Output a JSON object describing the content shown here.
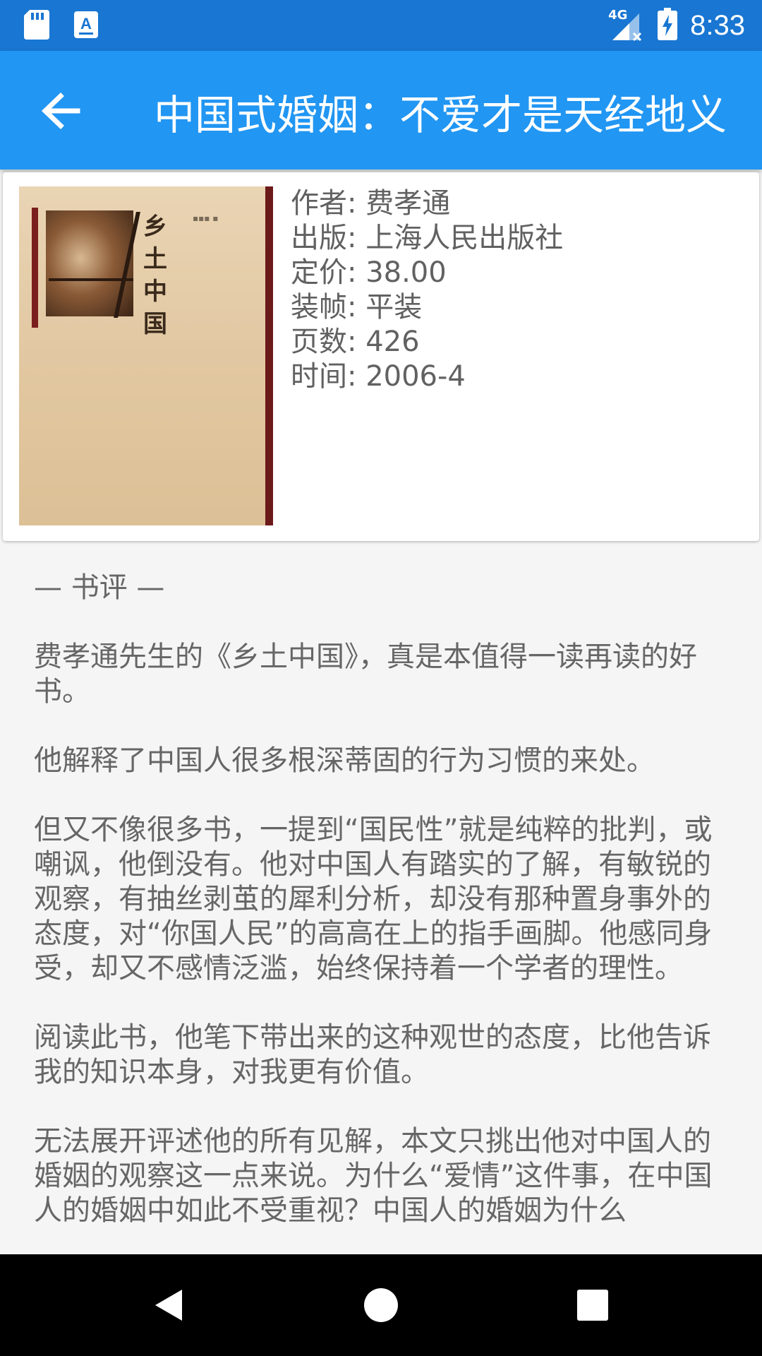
{
  "status_bar": {
    "time": "8:33",
    "network": "4G",
    "icons": [
      "sd-card-icon",
      "text-app-icon",
      "signal-icon",
      "battery-charging-icon"
    ]
  },
  "app_bar": {
    "title": "中国式婚姻：不爱才是天经地义",
    "back_icon": "arrow-back-icon"
  },
  "book": {
    "cover_title": "乡土中国",
    "meta": [
      "作者: 费孝通",
      "出版: 上海人民出版社",
      "定价: 38.00",
      "装帧: 平装",
      "页数: 426",
      "时间: 2006-4"
    ]
  },
  "review": {
    "heading": "— 书评 —",
    "paragraphs": [
      "费孝通先生的《乡土中国》，真是本值得一读再读的好书。",
      "他解释了中国人很多根深蒂固的行为习惯的来处。",
      "但又不像很多书，一提到“国民性”就是纯粹的批判，或嘲讽，他倒没有。他对中国人有踏实的了解，有敏锐的观察，有抽丝剥茧的犀利分析，却没有那种置身事外的态度，对“你国人民”的高高在上的指手画脚。他感同身受，却又不感情泛滥，始终保持着一个学者的理性。",
      "阅读此书，他笔下带出来的这种观世的态度，比他告诉我的知识本身，对我更有价值。",
      "无法展开评述他的所有见解，本文只挑出他对中国人的婚姻的观察这一点来说。为什么“爱情”这件事，在中国人的婚姻中如此不受重视？中国人的婚姻为什么"
    ]
  },
  "nav_bar": {
    "icons": [
      "back-triangle-icon",
      "home-circle-icon",
      "recents-square-icon"
    ]
  },
  "colors": {
    "status_bar": "#1976d2",
    "app_bar": "#2196f3",
    "background": "#f5f5f5",
    "text": "#616161"
  }
}
